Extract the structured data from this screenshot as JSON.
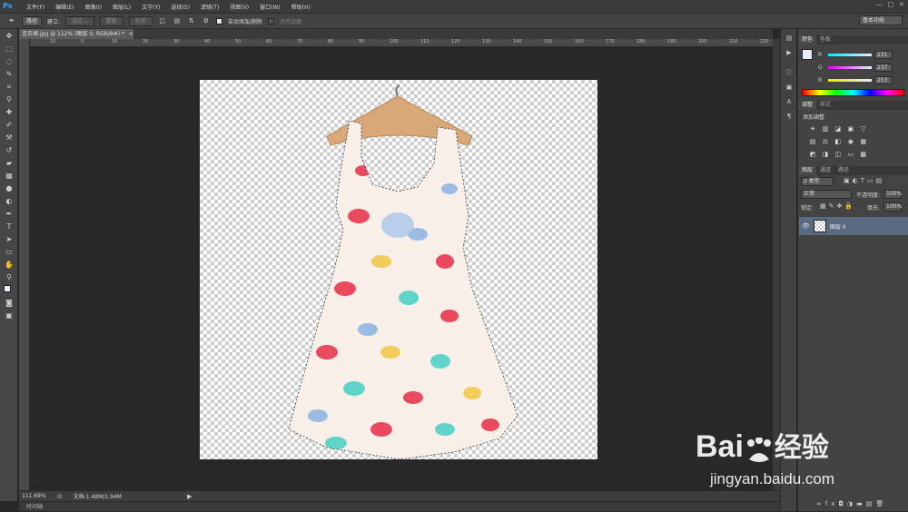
{
  "app": {
    "logo": "Ps"
  },
  "menu": [
    "文件(F)",
    "编辑(E)",
    "图像(I)",
    "图层(L)",
    "文字(Y)",
    "选择(S)",
    "滤镜(T)",
    "视图(V)",
    "窗口(W)",
    "帮助(H)"
  ],
  "window_controls": [
    "—",
    "□",
    "✕"
  ],
  "options": {
    "mode": "路径",
    "make_label": "建立:",
    "selection_btn": "选区...",
    "mask_btn": "蒙版",
    "shape_btn": "形状",
    "auto_add_delete": "自动添加/删除",
    "align_edges": "对齐边缘"
  },
  "workspace": "基本功能",
  "document": {
    "tab_title": "连衣裙.jpg @ 112% (图层 0, RGB/8#) *",
    "tab_close": "×",
    "ruler_top": [
      "10",
      "0",
      "10",
      "20",
      "30",
      "40",
      "50",
      "60",
      "70",
      "80",
      "90",
      "100",
      "110",
      "120",
      "130",
      "140",
      "150",
      "160",
      "170",
      "180",
      "190",
      "200",
      "210",
      "220"
    ],
    "zoom": "111.69%",
    "doc_info": "文档:1.48M/1.94M",
    "timeline": "时间轴"
  },
  "color_panel": {
    "tabs": [
      "颜色",
      "色板"
    ],
    "channels": [
      {
        "label": "R",
        "value": "231",
        "gradient": "#2fe6e6"
      },
      {
        "label": "G",
        "value": "237",
        "gradient": "#e62ee6"
      },
      {
        "label": "B",
        "value": "253",
        "gradient": "#e6e62e"
      }
    ]
  },
  "adjust_panel": {
    "tabs": [
      "调整",
      "样式"
    ],
    "title": "添加调整",
    "icons_row1": [
      "☀",
      "▥",
      "◪",
      "▣",
      "▽"
    ],
    "icons_row2": [
      "▤",
      "⚖",
      "◧",
      "◉",
      "▦"
    ],
    "icons_row3": [
      "◩",
      "◨",
      "◫",
      "▭",
      "▩"
    ]
  },
  "layers_panel": {
    "tabs": [
      "图层",
      "通道",
      "路径"
    ],
    "filter": "ρ 类型",
    "blend_mode": "正常",
    "opacity_label": "不透明度:",
    "opacity": "100%",
    "lock_label": "锁定:",
    "fill_label": "填充:",
    "fill": "100%",
    "layers": [
      {
        "name": "图层 0"
      }
    ],
    "footer_icons": [
      "∞",
      "fx",
      "◘",
      "◑",
      "▬",
      "▤",
      "🗑"
    ]
  },
  "watermark": {
    "brand": "Bai",
    "brand2": "经验",
    "url": "jingyan.baidu.com"
  }
}
